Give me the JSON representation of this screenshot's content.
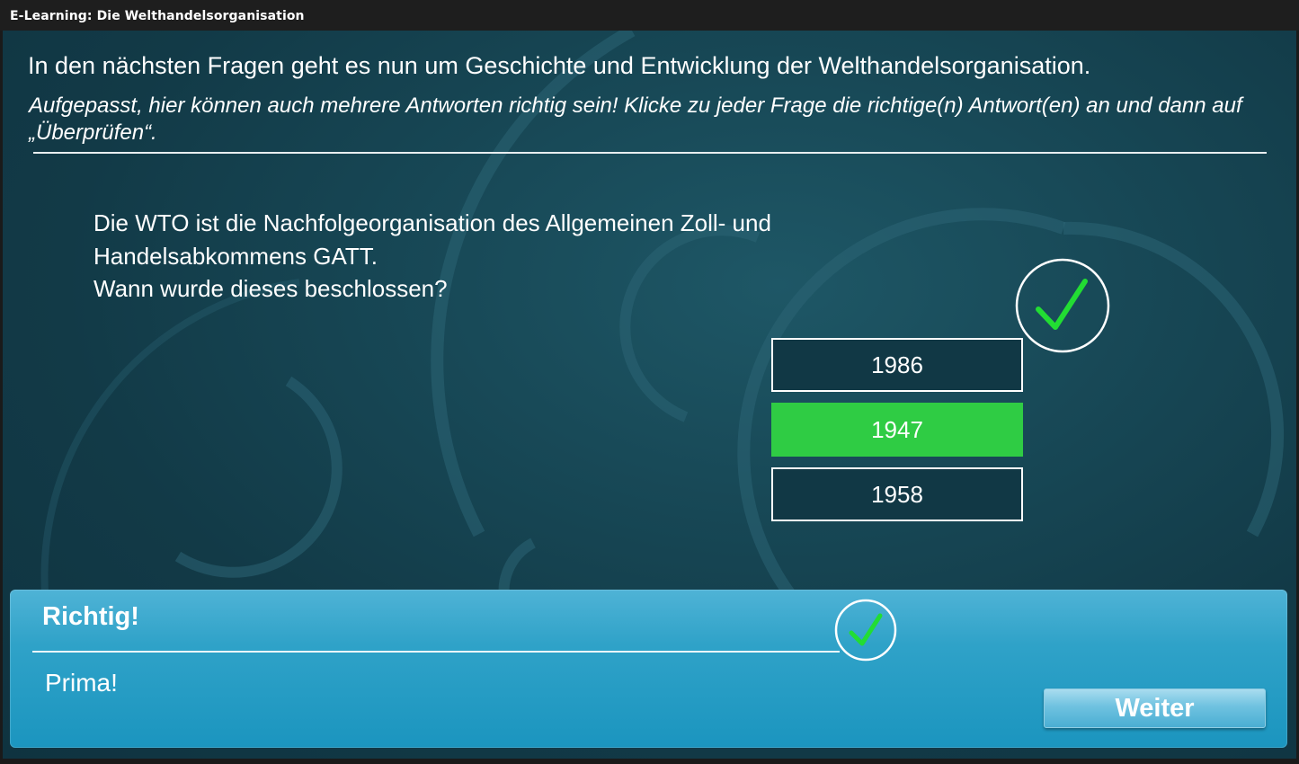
{
  "window": {
    "title": "E-Learning: Die Welthandelsorganisation"
  },
  "intro": {
    "title": "In den nächsten Fragen geht es nun um Geschichte und Entwicklung der Welthandelsorganisation.",
    "instruction": "Aufgepasst, hier können auch mehrere Antworten richtig sein! Klicke zu jeder Frage die richtige(n) Antwort(en) an und dann auf „Überprüfen“."
  },
  "question": {
    "lines": [
      "Die WTO ist die Nachfolgeorganisation des Allgemeinen Zoll- und",
      "Handelsabkommens GATT.",
      "Wann wurde dieses beschlossen?"
    ]
  },
  "answers": [
    {
      "label": "1986",
      "selected": false
    },
    {
      "label": "1947",
      "selected": true
    },
    {
      "label": "1958",
      "selected": false
    }
  ],
  "feedback": {
    "title": "Richtig!",
    "message": "Prima!",
    "continue_label": "Weiter"
  },
  "colors": {
    "background": "#174755",
    "correct_green": "#2fcc44",
    "feedback_blue": "#2fa2c8",
    "check_green": "#22dd33"
  },
  "icons": {
    "question_status": "checkmark-circle-icon",
    "feedback_status": "checkmark-circle-icon"
  }
}
